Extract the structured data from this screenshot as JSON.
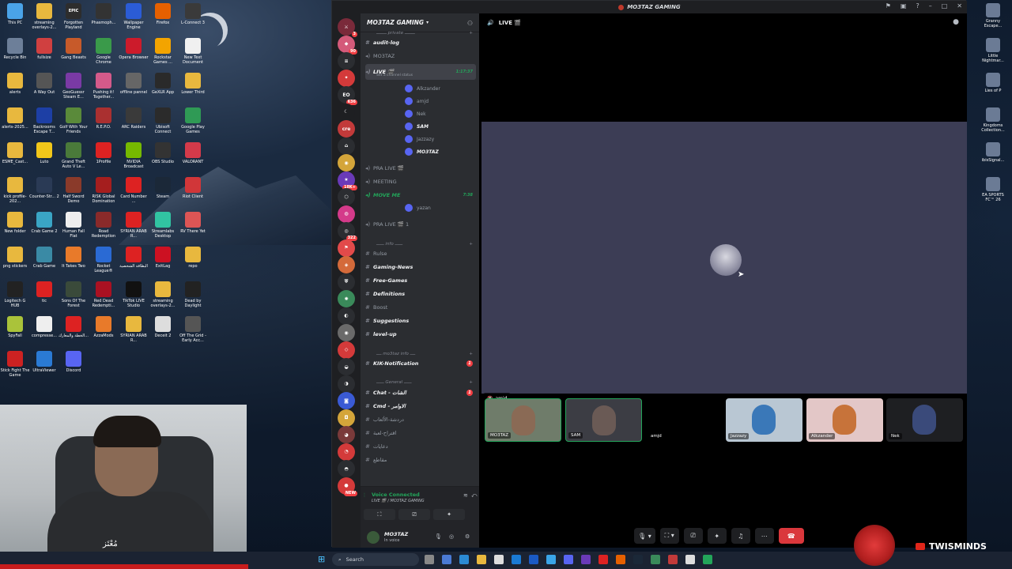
{
  "desktop": {
    "icons": [
      {
        "label": "This PC",
        "color": "#4aa3e8"
      },
      {
        "label": "streaming overlays-2...",
        "color": "#e8b83e"
      },
      {
        "label": "Forgotten Playland",
        "color": "#2d2d2d",
        "glyph": "EPIC"
      },
      {
        "label": "Phasmoph...",
        "color": "#333"
      },
      {
        "label": "Wallpaper Engine",
        "color": "#2b5cd6"
      },
      {
        "label": "Firefox",
        "color": "#e66000"
      },
      {
        "label": "L-Connect 3",
        "color": "#3a3a3a"
      },
      {
        "label": "Recycle Bin",
        "color": "#6d7f99"
      },
      {
        "label": "fullsize",
        "color": "#d04040"
      },
      {
        "label": "Gang Beasts",
        "color": "#c75a2a"
      },
      {
        "label": "Google Chrome",
        "color": "#3a9a4a"
      },
      {
        "label": "Opera Browser",
        "color": "#cc1b2b"
      },
      {
        "label": "Rockstar Games ...",
        "color": "#f3a400"
      },
      {
        "label": "New Text Document",
        "color": "#f0f0f0"
      },
      {
        "label": "alerts",
        "color": "#e8b83e"
      },
      {
        "label": "A Way Out",
        "color": "#555"
      },
      {
        "label": "GeoGuessr Steam E...",
        "color": "#7a3aa5"
      },
      {
        "label": "Pushing it! Together...",
        "color": "#d45a8a"
      },
      {
        "label": "offline pannel",
        "color": "#666"
      },
      {
        "label": "GeXLR App",
        "color": "#2a2a2a"
      },
      {
        "label": "Lower Third",
        "color": "#e8b83e"
      },
      {
        "label": "alerts-2025...",
        "color": "#e8b83e"
      },
      {
        "label": "Backrooms Escape T...",
        "color": "#1d3fa5"
      },
      {
        "label": "Golf With Your Friends",
        "color": "#5a8a3a"
      },
      {
        "label": "R.E.P.O.",
        "color": "#aa3030"
      },
      {
        "label": "ARC Raiders",
        "color": "#3a3a3a"
      },
      {
        "label": "Ubisoft Connect",
        "color": "#2b2b2b"
      },
      {
        "label": "Google Play Games",
        "color": "#2f9a55"
      },
      {
        "label": "ESME_Cast...",
        "color": "#e8b83e"
      },
      {
        "label": "Luto",
        "color": "#f2c71a"
      },
      {
        "label": "Grand Theft Auto V Le...",
        "color": "#4a7a3a"
      },
      {
        "label": "1Profile",
        "color": "#d22"
      },
      {
        "label": "NVIDIA Broadcast",
        "color": "#76b900"
      },
      {
        "label": "OBS Studio",
        "color": "#333"
      },
      {
        "label": "VALORANT",
        "color": "#d43a4a"
      },
      {
        "label": "kick profile-202...",
        "color": "#e8b83e"
      },
      {
        "label": "Counter-Str... 2",
        "color": "#2a3a55"
      },
      {
        "label": "Half Sword Demo",
        "color": "#8a3a2a"
      },
      {
        "label": "RISK Global Domination",
        "color": "#a51e1e"
      },
      {
        "label": "Card Number ...",
        "color": "#d22"
      },
      {
        "label": "Steam",
        "color": "#1b2838"
      },
      {
        "label": "Riot Client",
        "color": "#d13639"
      },
      {
        "label": "New folder",
        "color": "#e8b83e"
      },
      {
        "label": "Crab Game 2",
        "color": "#3aa5c5"
      },
      {
        "label": "Human Fall Flat",
        "color": "#eee"
      },
      {
        "label": "Road Redemption",
        "color": "#8a2a2a"
      },
      {
        "label": "SYRIAN ARAB R...",
        "color": "#d22"
      },
      {
        "label": "Streamlabs Desktop",
        "color": "#31c3a2"
      },
      {
        "label": "RV There Yet",
        "color": "#d55"
      },
      {
        "label": "png stickers",
        "color": "#e8b83e"
      },
      {
        "label": "Crab Game",
        "color": "#3a8aa5"
      },
      {
        "label": "It Takes Two",
        "color": "#e87a2a"
      },
      {
        "label": "Rocket League®",
        "color": "#2a6ad4"
      },
      {
        "label": "البطاقة الشخصية",
        "color": "#d22"
      },
      {
        "label": "ExitLag",
        "color": "#c12"
      },
      {
        "label": "repo",
        "color": "#e8b83e"
      },
      {
        "label": "Logitech G HUB",
        "color": "#222"
      },
      {
        "label": "tic",
        "color": "#d22"
      },
      {
        "label": "Sons Of The Forest",
        "color": "#3a4a3a"
      },
      {
        "label": "Red Dead Redempti...",
        "color": "#a12"
      },
      {
        "label": "TikTok LIVE Studio",
        "color": "#111"
      },
      {
        "label": "streaming overlays-2...",
        "color": "#e8b83e"
      },
      {
        "label": "Dead by Daylight",
        "color": "#222"
      },
      {
        "label": "SpyFall",
        "color": "#aac33a"
      },
      {
        "label": "compresse...",
        "color": "#eee"
      },
      {
        "label": "الخطة والمعارك...",
        "color": "#d22"
      },
      {
        "label": "AzzaMods",
        "color": "#e87a2a"
      },
      {
        "label": "SYRIAN ARAB R...",
        "color": "#e8b83e"
      },
      {
        "label": "Deceit 2",
        "color": "#ddd"
      },
      {
        "label": "Off The Grid - Early Acc...",
        "color": "#555"
      },
      {
        "label": "Stick Fight The Game",
        "color": "#c22"
      },
      {
        "label": "UltraViewer",
        "color": "#2a7ad4"
      },
      {
        "label": "Discord",
        "color": "#5865f2"
      }
    ],
    "right_icons": [
      {
        "label": "Granny Escape..."
      },
      {
        "label": "Little Nightmar..."
      },
      {
        "label": "Lies of P"
      },
      {
        "label": "Kingdoms Collection..."
      },
      {
        "label": "ibisSignal..."
      },
      {
        "label": "EA SPORTS FC™ 26"
      }
    ]
  },
  "webcam": {
    "signature": "مُعْتَز"
  },
  "discord": {
    "window_title": "MO3TAZ GAMING",
    "server_name": "MO3TAZ GAMING",
    "guild_badges": [
      "3",
      "90",
      "",
      "",
      "636",
      "",
      "",
      "",
      "",
      "18K+",
      "",
      "",
      "322",
      "",
      "",
      "",
      "",
      "",
      "",
      "",
      "",
      "",
      "",
      "",
      "",
      "",
      "",
      "NEW"
    ],
    "channels": [
      {
        "type": "category",
        "label": "ــــــــ private ــــــــ"
      },
      {
        "type": "text",
        "label": "audit-log",
        "bold": true
      },
      {
        "type": "voice",
        "label": "MO3TAZ"
      },
      {
        "type": "voice",
        "label": "LIVE 🎬",
        "active": true,
        "time": "1:17:37",
        "sub": "Set a channel status"
      },
      {
        "type": "user",
        "label": "Alkzander"
      },
      {
        "type": "user",
        "label": "amjd"
      },
      {
        "type": "user",
        "label": "Nek"
      },
      {
        "type": "user",
        "label": "SAM",
        "bold": true
      },
      {
        "type": "user",
        "label": "Jazzazy"
      },
      {
        "type": "user",
        "label": "MO3TAZ",
        "bold": true
      },
      {
        "type": "voice",
        "label": "PRA LIVE 🎬"
      },
      {
        "type": "voice",
        "label": "MEETING"
      },
      {
        "type": "voice",
        "label": "MOVE ME",
        "green": true,
        "time": "7:38"
      },
      {
        "type": "user",
        "label": "yazan"
      },
      {
        "type": "voice",
        "label": "PRA LIVE 🎬 1"
      },
      {
        "type": "category",
        "label": "ــــــ info ــــــ"
      },
      {
        "type": "text",
        "label": "Rulse"
      },
      {
        "type": "text",
        "label": "Gaming-News",
        "bold": true
      },
      {
        "type": "text",
        "label": "Free-Games",
        "bold": true
      },
      {
        "type": "text",
        "label": "Definitions",
        "bold": true
      },
      {
        "type": "text",
        "label": "Boost"
      },
      {
        "type": "text",
        "label": "Suggestions",
        "bold": true
      },
      {
        "type": "text",
        "label": "level-up",
        "bold": true
      },
      {
        "type": "category",
        "label": "ــــ mo3taz info ــــ"
      },
      {
        "type": "text",
        "label": "KIK-Notification",
        "bold": true,
        "badge": "1"
      },
      {
        "type": "category",
        "label": "ــــــ General ــــــ"
      },
      {
        "type": "text",
        "label": "Chat - الشات",
        "bold": true,
        "badge": "1"
      },
      {
        "type": "text",
        "label": "Cmd - الاوامر",
        "bold": true
      },
      {
        "type": "text",
        "label": "دردشة-الألعاب"
      },
      {
        "type": "text",
        "label": "اقتراح-لعبة"
      },
      {
        "type": "text",
        "label": "دعايات"
      },
      {
        "type": "text",
        "label": "مقاطع"
      }
    ],
    "voice_panel": {
      "status": "Voice Connected",
      "channel": "LIVE 🎬 / MO3TAZ GAMING"
    },
    "user_panel": {
      "name": "MO3TAZ",
      "status": "In voice"
    },
    "stage": {
      "channel_title": "LIVE 🎬",
      "focused_user": "amjd",
      "participants": [
        {
          "name": "MO3TAZ",
          "speaking": true,
          "bg": "#6f7c6a",
          "face": "#8a6a55"
        },
        {
          "name": "SAM",
          "speaking": true,
          "bg": "#3c3d44",
          "face": "#6a5a55"
        },
        {
          "name": "amjd",
          "speaking": false,
          "bg": "#000000",
          "face": "#000000"
        },
        {
          "name": "Jazzazy",
          "speaking": false,
          "bg": "#b9c7d3",
          "face": "#3a78b8"
        },
        {
          "name": "Alkzander",
          "speaking": false,
          "bg": "#e3c7c7",
          "face": "#c7733a"
        },
        {
          "name": "Nek",
          "speaking": false,
          "bg": "#1e1f22",
          "face": "#3a4a7a"
        }
      ]
    }
  },
  "taskbar": {
    "search_placeholder": "Search"
  },
  "branding": {
    "channel": "TWISMINDS"
  }
}
